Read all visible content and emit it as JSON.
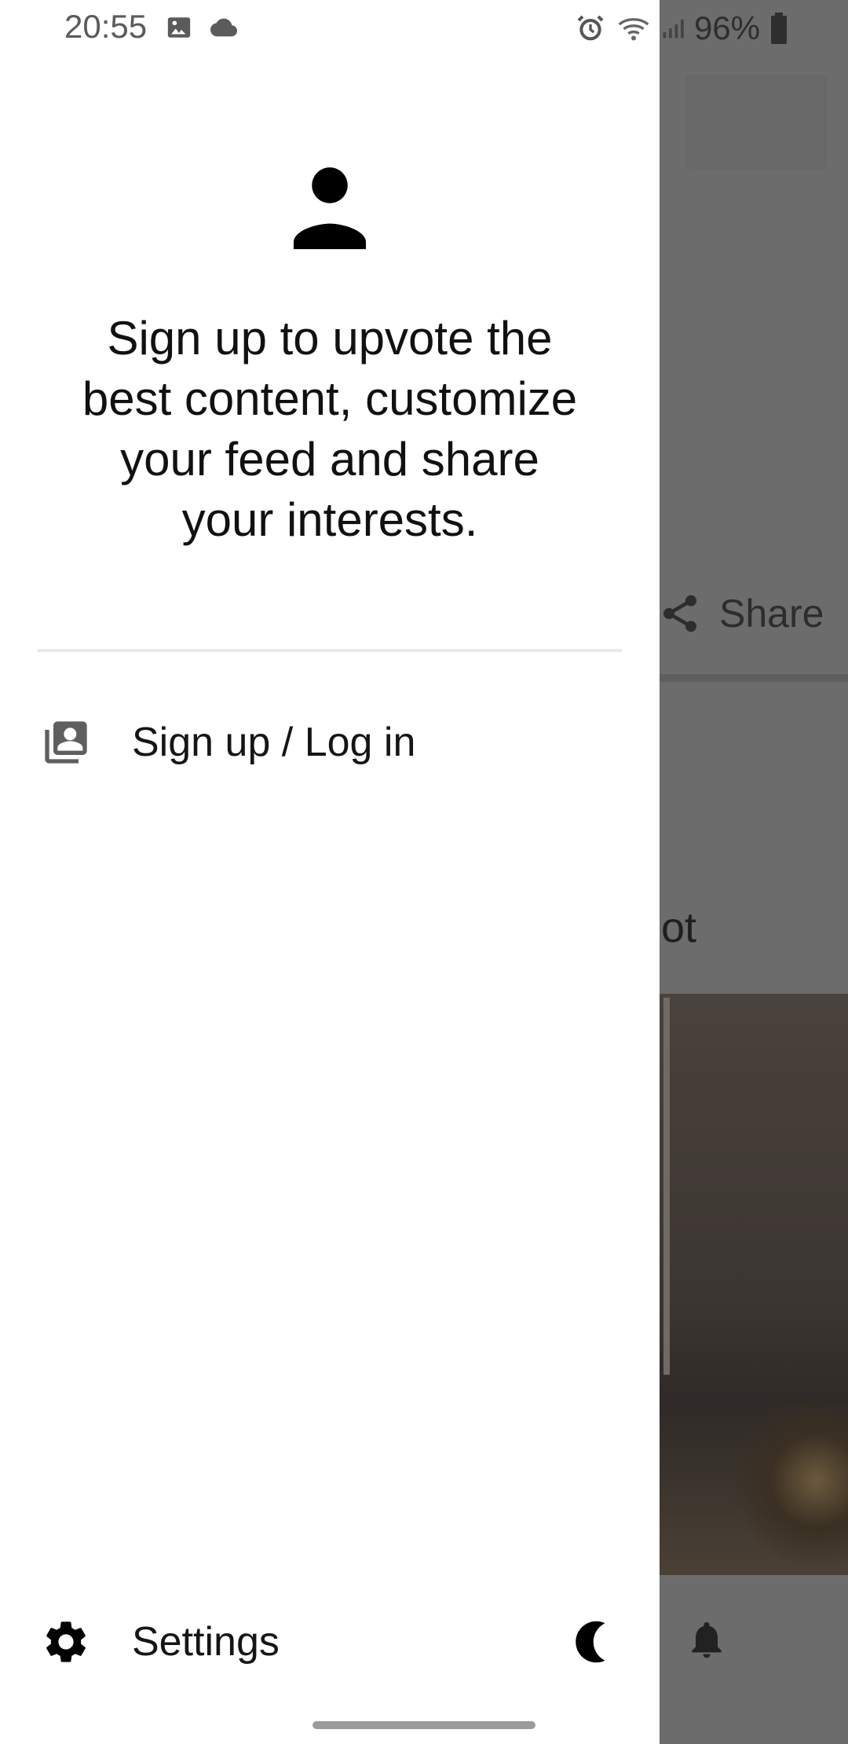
{
  "status_bar": {
    "time": "20:55",
    "battery": "96%",
    "icons": [
      "gallery-icon",
      "cloud-icon",
      "alarm-icon",
      "wifi-icon",
      "signal-icon",
      "battery-icon"
    ]
  },
  "drawer": {
    "message": "Sign up to upvote the best content, customize your feed and share your interests.",
    "menu": {
      "login_label": "Sign up / Log in",
      "settings_label": "Settings"
    },
    "icons": {
      "profile": "person-icon",
      "login": "account-box-icon",
      "settings": "gear-icon",
      "theme": "moon-icon"
    }
  },
  "background": {
    "share_label": "Share",
    "title_fragment": "lot"
  },
  "colors": {
    "drawer_bg": "#ffffff",
    "scrim": "#6c6c6c",
    "text": "#111111"
  }
}
